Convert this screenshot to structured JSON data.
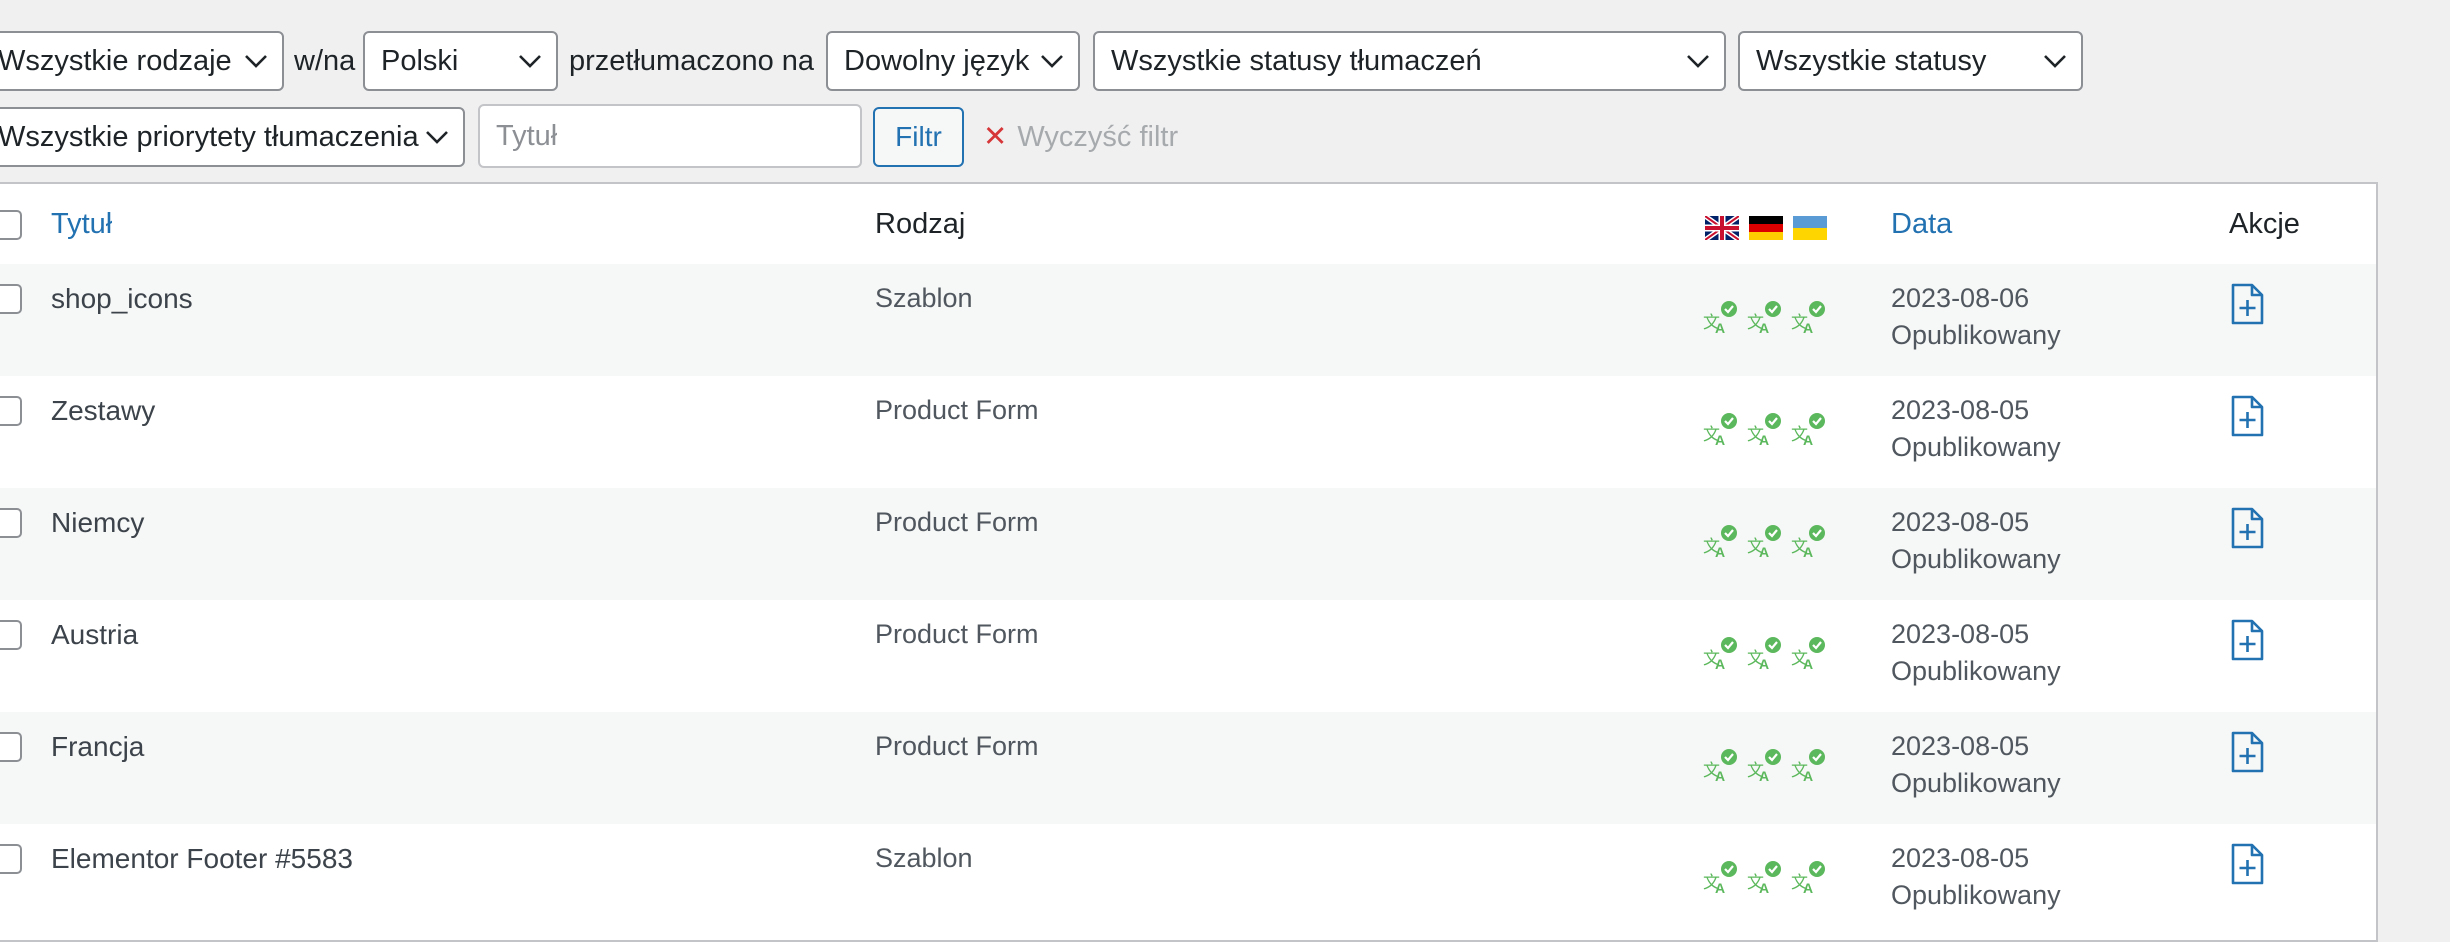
{
  "filters": {
    "post_type": "Wszystkie rodzaje",
    "to_from_label": "w/na",
    "language": "Polski",
    "translated_to_label": "przetłumaczono na",
    "target_language": "Dowolny język",
    "translation_status": "Wszystkie statusy tłumaczeń",
    "status": "Wszystkie statusy",
    "priority": "Wszystkie priorytety tłumaczenia",
    "title_placeholder": "Tytuł",
    "filter_button": "Filtr",
    "clear_filter": "Wyczyść filtr"
  },
  "table": {
    "columns": {
      "title": "Tytuł",
      "type": "Rodzaj",
      "date": "Data",
      "actions": "Akcje"
    },
    "flags": [
      "gb-flag-icon",
      "de-flag-icon",
      "ua-flag-icon"
    ],
    "rows": [
      {
        "title": "shop_icons",
        "type": "Szablon",
        "date": "2023-08-06",
        "status": "Opublikowany"
      },
      {
        "title": "Zestawy",
        "type": "Product Form",
        "date": "2023-08-05",
        "status": "Opublikowany"
      },
      {
        "title": "Niemcy",
        "type": "Product Form",
        "date": "2023-08-05",
        "status": "Opublikowany"
      },
      {
        "title": "Austria",
        "type": "Product Form",
        "date": "2023-08-05",
        "status": "Opublikowany"
      },
      {
        "title": "Francja",
        "type": "Product Form",
        "date": "2023-08-05",
        "status": "Opublikowany"
      },
      {
        "title": "Elementor Footer #5583",
        "type": "Szablon",
        "date": "2023-08-05",
        "status": "Opublikowany"
      }
    ]
  },
  "colors": {
    "link": "#2271b1",
    "translated_green": "#5cb85c",
    "row_alt": "#f6f7f7"
  }
}
